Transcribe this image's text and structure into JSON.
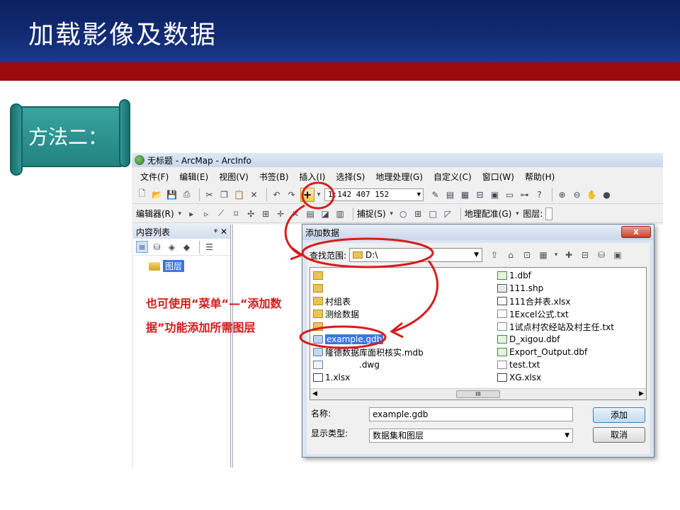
{
  "slide": {
    "title": "加载影像及数据",
    "method_label": "方法二：",
    "annotation": "也可使用“菜单“—“添加数据”功能添加所需图层"
  },
  "colors": {
    "header_blue": "#122b73",
    "band_red": "#9c0a10",
    "annotation_red": "#d21a1a",
    "selection_blue": "#3a78d8",
    "scroll_teal": "#21837f"
  },
  "arcmap": {
    "window_title": "无标题 - ArcMap - ArcInfo",
    "menu": [
      "文件(F)",
      "编辑(E)",
      "视图(V)",
      "书签(B)",
      "插入(I)",
      "选择(S)",
      "地理处理(G)",
      "自定义(C)",
      "窗口(W)",
      "帮助(H)"
    ],
    "scale": "1:142 407 152",
    "toolbar2": {
      "editor": "编辑器(R)",
      "snapping": "捕捉(S)",
      "georeferencing": "地理配准(G)",
      "layer": "图层:"
    },
    "toc": {
      "title": "内容列表",
      "pin": "ᵠ ✕",
      "layers_label": "图层"
    },
    "icons": {
      "add_data": "add-data-icon",
      "new": "new-document-icon",
      "open": "open-folder-icon",
      "save": "save-icon",
      "print": "print-icon",
      "zoom_in": "zoom-in-icon",
      "zoom_out": "zoom-out-icon",
      "pan": "pan-icon",
      "globe": "globe-icon"
    }
  },
  "dialog": {
    "title": "添加数据",
    "close": "x",
    "look_in_label": "查找范围:",
    "look_in_value": "D:\\",
    "files_left": [
      {
        "name": "",
        "icon": "folder"
      },
      {
        "name": "",
        "icon": "folder"
      },
      {
        "name": "村组表",
        "icon": "folder"
      },
      {
        "name": "测绘数据",
        "icon": "folder"
      },
      {
        "name": "",
        "icon": "folder"
      },
      {
        "name": "example.gdb",
        "icon": "gdb",
        "selected": true
      },
      {
        "name": "隆德数据库面积核实.mdb",
        "icon": "mdb"
      },
      {
        "name": ".dwg",
        "icon": "dwg"
      },
      {
        "name": "1.xlsx",
        "icon": "xls"
      }
    ],
    "files_right": [
      {
        "name": "1.dbf",
        "icon": "dbf"
      },
      {
        "name": "111.shp",
        "icon": "shp"
      },
      {
        "name": "111合并表.xlsx",
        "icon": "xls"
      },
      {
        "name": "1Excel公式.txt",
        "icon": "txt"
      },
      {
        "name": "1试点村农经站及村主任.txt",
        "icon": "txt"
      },
      {
        "name": "D_xigou.dbf",
        "icon": "dbf"
      },
      {
        "name": "Export_Output.dbf",
        "icon": "dbf"
      },
      {
        "name": "test.txt",
        "icon": "txt"
      },
      {
        "name": "XG.xlsx",
        "icon": "xls"
      }
    ],
    "scroll_thumb": "III",
    "name_label": "名称:",
    "name_value": "example.gdb",
    "type_label": "显示类型:",
    "type_value": "数据集和图层",
    "add_button": "添加",
    "cancel_button": "取消"
  }
}
